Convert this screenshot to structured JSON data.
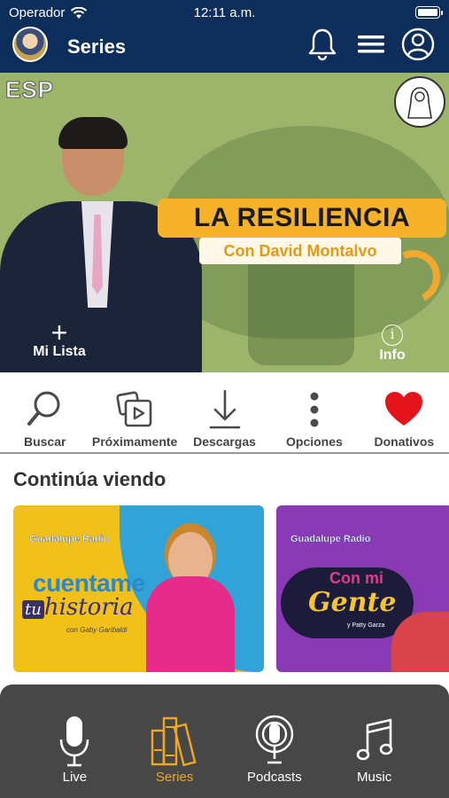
{
  "status_bar": {
    "carrier": "Operador",
    "time": "12:11 a.m."
  },
  "header": {
    "title": "Series"
  },
  "banner": {
    "lang_badge": "ESP",
    "title": "LA RESILIENCIA",
    "subtitle": "Con David Montalvo",
    "add_label": "Mi Lista",
    "info_label": "Info"
  },
  "actions": [
    {
      "label": "Buscar",
      "icon": "search-icon"
    },
    {
      "label": "Próximamente",
      "icon": "upcoming-icon"
    },
    {
      "label": "Descargas",
      "icon": "download-icon"
    },
    {
      "label": "Opciones",
      "icon": "more-icon"
    },
    {
      "label": "Donativos",
      "icon": "heart-icon"
    }
  ],
  "continue_watching": {
    "title": "Continúa viendo",
    "cards": [
      {
        "logo": "Guadalupe Radio",
        "line1": "cuentame",
        "line2_prefix": "tu",
        "line2": "historia",
        "byline": "con Gaby Garibaldi"
      },
      {
        "logo": "Guadalupe Radio",
        "line1": "Con mi",
        "line2": "Gente",
        "byline": "y Patty Garza"
      }
    ]
  },
  "tabbar": {
    "items": [
      {
        "label": "Live",
        "icon": "microphone-icon",
        "active": false
      },
      {
        "label": "Series",
        "icon": "series-books-icon",
        "active": true
      },
      {
        "label": "Podcasts",
        "icon": "podcast-icon",
        "active": false
      },
      {
        "label": "Music",
        "icon": "music-note-icon",
        "active": false
      }
    ]
  },
  "colors": {
    "header_bg": "#0d2d5a",
    "tab_active": "#f0a820",
    "tabbar_bg": "#474747",
    "banner_title_bg": "#f6b32a",
    "heart": "#e3141b"
  }
}
